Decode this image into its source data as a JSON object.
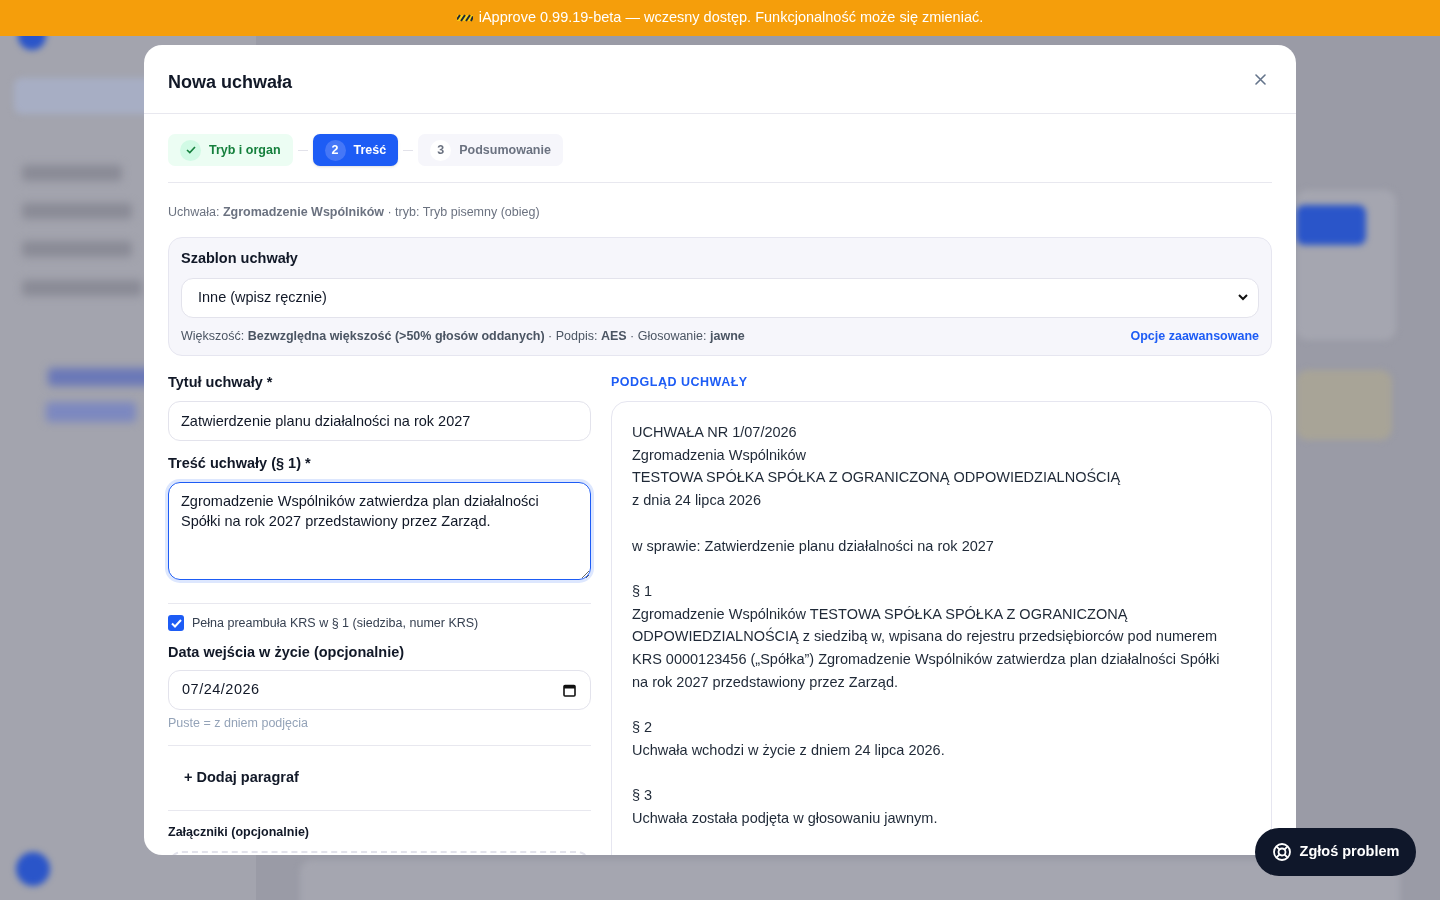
{
  "banner": {
    "text": "iApprove 0.99.19-beta — wczesny dostęp. Funkcjonalność może się zmieniać."
  },
  "dialog": {
    "title": "Nowa uchwała",
    "steps": [
      {
        "label": "Tryb i organ",
        "kind": "done",
        "selected": false
      },
      {
        "number": "2",
        "label": "Treść",
        "kind": "current",
        "selected": true
      },
      {
        "number": "3",
        "label": "Podsumowanie",
        "kind": "todo",
        "selected": false
      }
    ],
    "context_line": "Uchwała: **Zgromadzenie Wspólników** · tryb: Tryb pisemny (obieg)",
    "template": {
      "label": "Szablon uchwały",
      "value": "Inne (wpisz ręcznie)",
      "info": "Większość: **Bezwzględna większość (>50% głosów oddanych)** · Podpis: **AES** · Głosowanie: **jawne**",
      "advanced_link": "Opcje zaawansowane"
    },
    "title_field": {
      "label": "Tytuł uchwały *",
      "value": "Zatwierdzenie planu działalności na rok 2027"
    },
    "content_field": {
      "label": "Treść uchwały (§ 1) *",
      "value": "Zgromadzenie Wspólników zatwierdza plan działalności Spółki na rok 2027 przedstawiony przez Zarząd.",
      "focused": true
    },
    "preamble_checkbox": {
      "label": "Pełna preambuła KRS w § 1 (siedziba, numer KRS)",
      "checked": true
    },
    "date_field": {
      "label": "Data wejścia w życie (opcjonalnie)",
      "value": "07/24/2026",
      "hint": "Puste = z dniem podjęcia"
    },
    "add_paragraph": "+ Dodaj paragraf",
    "attachments": {
      "label": "Załączniki (opcjonalnie)"
    },
    "preview": {
      "heading": "PODGLĄD UCHWAŁY",
      "blocks": [
        [
          "UCHWAŁA NR 1/07/2026",
          "Zgromadzenia Wspólników",
          "TESTOWA SPÓŁKA SPÓŁKA Z OGRANICZONĄ ODPOWIEDZIALNOŚCIĄ",
          "z dnia 24 lipca 2026"
        ],
        [
          "w sprawie: Zatwierdzenie planu działalności na rok 2027"
        ],
        [
          "§ 1",
          "Zgromadzenie Wspólników TESTOWA SPÓŁKA SPÓŁKA Z OGRANICZONĄ ODPOWIEDZIALNOŚCIĄ z siedzibą w, wpisana do rejestru przedsiębiorców pod numerem KRS 0000123456 („Spółka”) Zgromadzenie Wspólników zatwierdza plan działalności Spółki na rok 2027 przedstawiony przez Zarząd."
        ],
        [
          "§ 2",
          "Uchwała wchodzi w życie z dniem 24 lipca 2026."
        ],
        [
          "§ 3",
          "Uchwała została podjęta w głosowaniu jawnym."
        ]
      ]
    }
  },
  "report_button": "Zgłoś problem"
}
